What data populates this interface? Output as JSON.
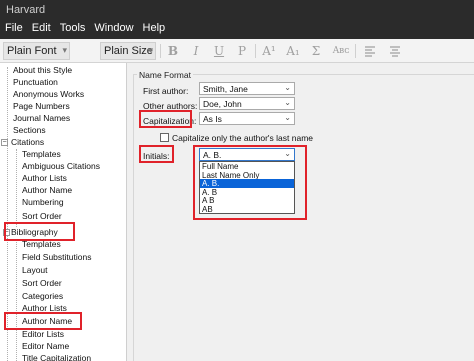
{
  "window": {
    "title": "Harvard"
  },
  "menu": [
    "File",
    "Edit",
    "Tools",
    "Window",
    "Help"
  ],
  "toolbar": {
    "font_value": "Plain Font",
    "size_value": "Plain Size",
    "bold": "B",
    "italic": "I",
    "underline": "U",
    "plain": "P",
    "superscript": "A¹",
    "subscript": "A₁",
    "symbol": "Σ",
    "smallcaps": "Aʙᴄ"
  },
  "tree": {
    "items": [
      "About this Style",
      "Punctuation",
      "Anonymous Works",
      "Page Numbers",
      "Journal Names",
      "Sections",
      "Citations",
      "Templates",
      "Ambiguous Citations",
      "Author Lists",
      "Author Name",
      "Numbering",
      "Sort Order",
      "Bibliography",
      "Templates",
      "Field Substitutions",
      "Layout",
      "Sort Order",
      "Categories",
      "Author Lists",
      "Author Name",
      "Editor Lists",
      "Editor Name",
      "Title Capitalization"
    ]
  },
  "name_format": {
    "group_title": "Name Format",
    "first_author_label": "First author:",
    "first_author_value": "Smith, Jane",
    "other_authors_label": "Other authors:",
    "other_authors_value": "Doe, John",
    "capitalization_label": "Capitalization:",
    "capitalization_value": "As Is",
    "cap_only_last_label": "Capitalize only the author's last name",
    "initials_label": "Initials:",
    "initials_value": "A. B.",
    "initials_options": [
      "Full Name",
      "Last Name Only",
      "A. B.",
      "A. B",
      "A B",
      "AB"
    ],
    "initials_selected_index": 2
  },
  "colors": {
    "highlight_box": "#e0222a",
    "selection": "#0a64d8"
  }
}
